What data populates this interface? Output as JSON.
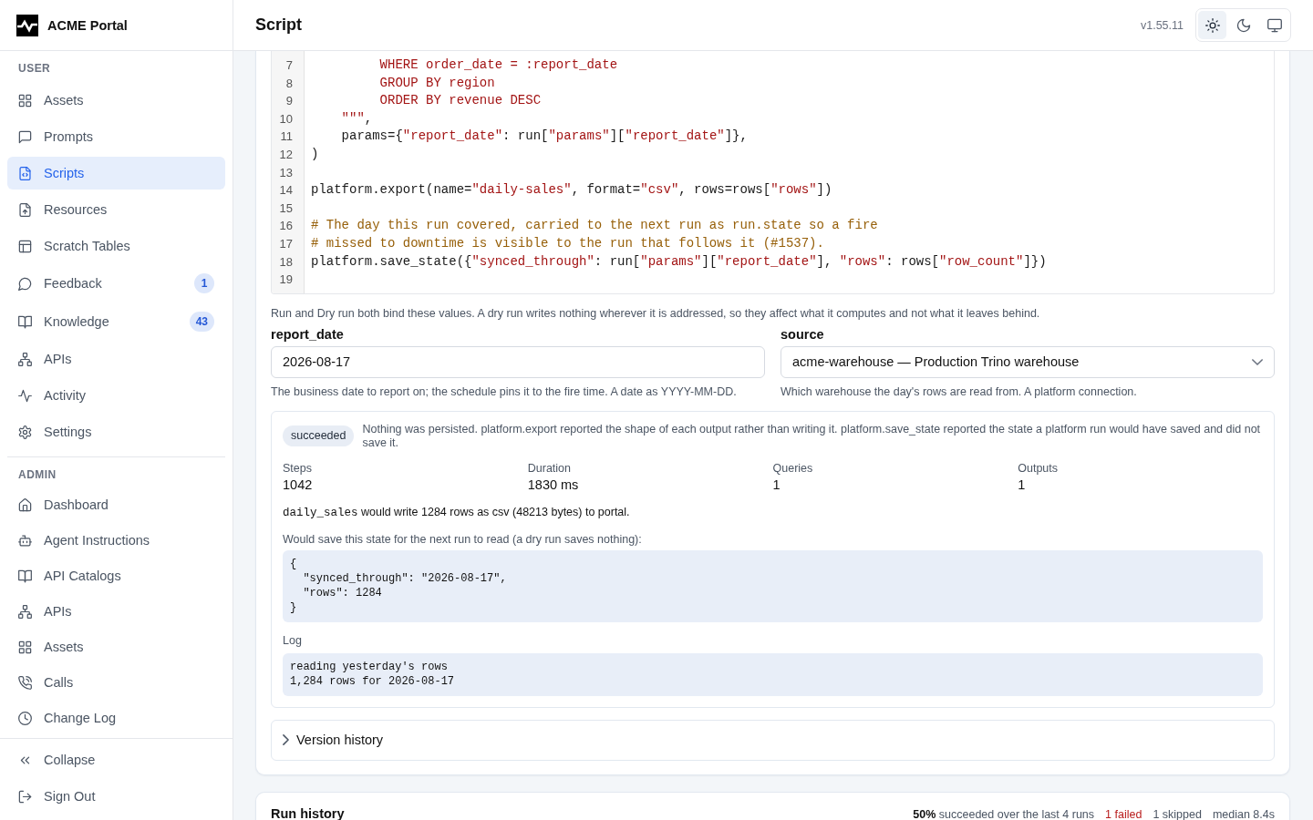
{
  "sidebar": {
    "brand": "ACME Portal",
    "sections": [
      {
        "title": "USER",
        "items": [
          {
            "label": "Assets",
            "selected": false
          },
          {
            "label": "Prompts",
            "selected": false
          },
          {
            "label": "Scripts",
            "selected": true
          },
          {
            "label": "Resources",
            "selected": false
          },
          {
            "label": "Scratch Tables",
            "selected": false
          },
          {
            "label": "Feedback",
            "selected": false,
            "badge": "1"
          },
          {
            "label": "Knowledge",
            "selected": false,
            "badge": "43"
          },
          {
            "label": "APIs",
            "selected": false
          },
          {
            "label": "Activity",
            "selected": false
          },
          {
            "label": "Settings",
            "selected": false
          }
        ]
      },
      {
        "title": "ADMIN",
        "items": [
          {
            "label": "Dashboard",
            "selected": false
          },
          {
            "label": "Agent Instructions",
            "selected": false
          },
          {
            "label": "API Catalogs",
            "selected": false
          },
          {
            "label": "APIs",
            "selected": false
          },
          {
            "label": "Assets",
            "selected": false
          },
          {
            "label": "Calls",
            "selected": false
          },
          {
            "label": "Change Log",
            "selected": false
          }
        ]
      }
    ],
    "footer": [
      {
        "label": "Collapse"
      },
      {
        "label": "Sign Out"
      }
    ]
  },
  "header": {
    "title": "Script",
    "version": "v1.55.11",
    "theme_options": [
      {
        "kind": "light",
        "selected": true
      },
      {
        "kind": "dark",
        "selected": false
      },
      {
        "kind": "system",
        "selected": false
      }
    ]
  },
  "script_card": {
    "code_lines": [
      {
        "number": "7",
        "tokens": [
          {
            "kind": "string",
            "text": "         WHERE order_date = :report_date"
          }
        ]
      },
      {
        "number": "8",
        "tokens": [
          {
            "kind": "string",
            "text": "         GROUP BY region"
          }
        ]
      },
      {
        "number": "9",
        "tokens": [
          {
            "kind": "string",
            "text": "         ORDER BY revenue DESC"
          }
        ]
      },
      {
        "number": "10",
        "tokens": [
          {
            "kind": "string",
            "text": "    \"\"\""
          },
          {
            "kind": "plain",
            "text": ","
          }
        ]
      },
      {
        "number": "11",
        "tokens": [
          {
            "kind": "plain",
            "text": "    params={"
          },
          {
            "kind": "string",
            "text": "\"report_date\""
          },
          {
            "kind": "plain",
            "text": ": run["
          },
          {
            "kind": "string",
            "text": "\"params\""
          },
          {
            "kind": "plain",
            "text": "]["
          },
          {
            "kind": "string",
            "text": "\"report_date\""
          },
          {
            "kind": "plain",
            "text": "]},"
          }
        ]
      },
      {
        "number": "12",
        "tokens": [
          {
            "kind": "plain",
            "text": ")"
          }
        ]
      },
      {
        "number": "13"
      },
      {
        "number": "14",
        "tokens": [
          {
            "kind": "plain",
            "text": "platform.export(name="
          },
          {
            "kind": "string",
            "text": "\"daily-sales\""
          },
          {
            "kind": "plain",
            "text": ", format="
          },
          {
            "kind": "string",
            "text": "\"csv\""
          },
          {
            "kind": "plain",
            "text": ", rows=rows["
          },
          {
            "kind": "string",
            "text": "\"rows\""
          },
          {
            "kind": "plain",
            "text": "])"
          }
        ]
      },
      {
        "number": "15"
      },
      {
        "number": "16",
        "tokens": [
          {
            "kind": "comment",
            "text": "# The day this run covered, carried to the next run as run.state so a fire"
          }
        ]
      },
      {
        "number": "17",
        "tokens": [
          {
            "kind": "comment",
            "text": "# missed to downtime is visible to the run that follows it (#1537)."
          }
        ]
      },
      {
        "number": "18",
        "tokens": [
          {
            "kind": "plain",
            "text": "platform.save_state({"
          },
          {
            "kind": "string",
            "text": "\"synced_through\""
          },
          {
            "kind": "plain",
            "text": ": run["
          },
          {
            "kind": "string",
            "text": "\"params\""
          },
          {
            "kind": "plain",
            "text": "]["
          },
          {
            "kind": "string",
            "text": "\"report_date\""
          },
          {
            "kind": "plain",
            "text": "], "
          },
          {
            "kind": "string",
            "text": "\"rows\""
          },
          {
            "kind": "plain",
            "text": ": rows["
          },
          {
            "kind": "string",
            "text": "\"row_count\""
          },
          {
            "kind": "plain",
            "text": "]})"
          }
        ]
      },
      {
        "number": "19"
      }
    ],
    "parameters_note": "Run and Dry run both bind these values. A dry run writes nothing wherever it is addressed, so they affect what it computes and not what it leaves behind.",
    "parameters": [
      {
        "name": "report_date",
        "kind": "text",
        "value": "2026-08-17",
        "hint": "The business date to report on; the schedule pins it to the fire time. A date as YYYY-MM-DD."
      },
      {
        "name": "source",
        "kind": "select",
        "value": "acme-warehouse — Production Trino warehouse",
        "hint": "Which warehouse the day's rows are read from. A platform connection."
      }
    ],
    "dry_run": {
      "status": "succeeded",
      "message": "Nothing was persisted. platform.export reported the shape of each output rather than writing it. platform.save_state reported the state a platform run would have saved and did not save it.",
      "stats": [
        {
          "label": "Steps",
          "value": "1042"
        },
        {
          "label": "Duration",
          "value": "1830 ms"
        },
        {
          "label": "Queries",
          "value": "1"
        },
        {
          "label": "Outputs",
          "value": "1"
        }
      ],
      "output": {
        "name": "daily_sales",
        "text": "would write 1284 rows as csv (48213 bytes) to portal."
      },
      "state_caption": "Would save this state for the next run to read (a dry run saves nothing):",
      "state_lines": [
        "{",
        "  \"synced_through\": \"2026-08-17\",",
        "  \"rows\": 1284",
        "}"
      ],
      "log_label": "Log",
      "log_lines": [
        "reading yesterday's rows",
        "1,284 rows for 2026-08-17"
      ]
    },
    "version_history": {
      "label": "Version history",
      "expanded": false
    }
  },
  "run_history": {
    "title": "Run history",
    "stats": [
      {
        "kind": "rate",
        "text": "**50%** succeeded over the last 4 runs"
      },
      {
        "kind": "failed",
        "text": "1 failed"
      },
      {
        "kind": "skipped",
        "text": "1 skipped"
      },
      {
        "kind": "median",
        "text": "median 8.4s"
      }
    ]
  }
}
